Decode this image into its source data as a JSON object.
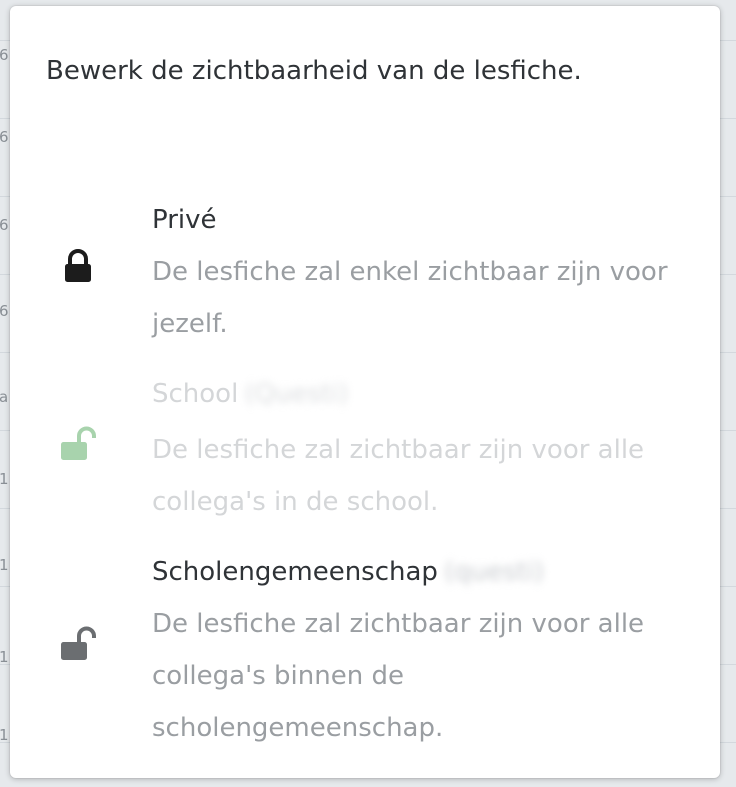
{
  "popover": {
    "intro": "Bewerk de zichtbaarheid van de lesfiche."
  },
  "options": [
    {
      "title": "Privé",
      "suffix": "",
      "description": "De lesfiche zal enkel zichtbaar zijn voor jezelf.",
      "icon": "lock-closed-icon",
      "icon_color": "#1c1c1c",
      "enabled": true
    },
    {
      "title": "School",
      "suffix": "(Questi)",
      "description": "De lesfiche zal zichtbaar zijn voor alle collega's in de school.",
      "icon": "lock-open-icon",
      "icon_color": "#a8d3ad",
      "enabled": false
    },
    {
      "title": "Scholengemeenschap",
      "suffix": "(questi)",
      "description": "De lesfiche zal zichtbaar zijn voor alle collega's binnen de scholengemeenschap.",
      "icon": "lock-open-icon",
      "icon_color": "#6b6e71",
      "enabled": true
    }
  ],
  "background": {
    "edge_glyphs": [
      "6",
      "6",
      "6",
      "6",
      "a",
      "1",
      "1",
      "1",
      "1"
    ]
  }
}
